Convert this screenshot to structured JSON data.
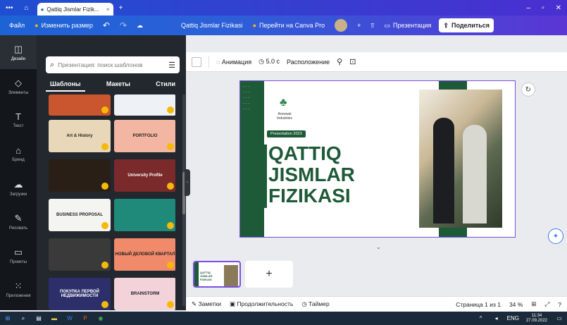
{
  "browser": {
    "tab_title": "Qattiq Jismlar Fizik...",
    "menu_icon": "ellipsis-icon",
    "home_icon": "home-icon",
    "new_tab": "+",
    "window_controls": [
      "–",
      "▫",
      "✕"
    ]
  },
  "menubar": {
    "file": "Файл",
    "resize": "Изменить размер",
    "doc_title": "Qattiq Jismlar Fizikasi",
    "pro": "Перейти на Canva Pro",
    "add": "+",
    "present": "Презентация",
    "share": "Поделиться"
  },
  "rail": [
    {
      "label": "Дизайн",
      "icon": "layout-icon"
    },
    {
      "label": "Элементы",
      "icon": "shapes-icon"
    },
    {
      "label": "Текст",
      "icon": "text-icon"
    },
    {
      "label": "Бренд",
      "icon": "brand-icon"
    },
    {
      "label": "Загрузки",
      "icon": "upload-icon"
    },
    {
      "label": "Рисовать",
      "icon": "draw-icon"
    },
    {
      "label": "Проекты",
      "icon": "folder-icon"
    },
    {
      "label": "Приложения",
      "icon": "apps-icon"
    }
  ],
  "panel": {
    "search_placeholder": "Презентация: поиск шаблонов",
    "tabs": [
      "Шаблоны",
      "Макеты",
      "Стили"
    ],
    "thumbs": [
      {
        "text": "",
        "bg": "#c9562e"
      },
      {
        "text": "",
        "bg": "#eef2f6"
      },
      {
        "text": "Art & History",
        "bg": "#e8d7b8"
      },
      {
        "text": "PORTFOLIO",
        "bg": "#f3b6a2"
      },
      {
        "text": "",
        "bg": "#2a1f17"
      },
      {
        "text": "University Profile",
        "bg": "#7a2a2a"
      },
      {
        "text": "BUSINESS PROPOSAL",
        "bg": "#f4f4f0"
      },
      {
        "text": "",
        "bg": "#1f8a7a"
      },
      {
        "text": "",
        "bg": "#3a3a3a"
      },
      {
        "text": "НОВЫЙ ДЕЛОВОЙ КВАРТАЛ",
        "bg": "#f08a6a"
      },
      {
        "text": "ПОКУПКА ПЕРВОЙ НЕДВИЖИМОСТИ",
        "bg": "#2d2f6b"
      },
      {
        "text": "BRAINSTORM",
        "bg": "#f3d3d9"
      }
    ]
  },
  "toolbar": {
    "animation": "Анимация",
    "duration": "5.0 с",
    "position": "Расположение"
  },
  "slide": {
    "company": "Arowwai Industries",
    "badge": "Presentation 2023",
    "title_lines": [
      "QATTIQ",
      "JISMLAR",
      "FIZIKASI"
    ],
    "green": "#1e5a37",
    "accent": "#2e8a4f"
  },
  "pages": {
    "thumb_title": "QATTIQ JISMLAR FIZIKASI",
    "add": "+"
  },
  "bottombar": {
    "notes": "Заметки",
    "duration": "Продолжительность",
    "timer": "Таймер",
    "page": "Страница 1 из 1",
    "zoom": "34 %"
  },
  "taskbar": {
    "lang": "ENG",
    "time": "11:34",
    "date": "27.09.2022"
  }
}
